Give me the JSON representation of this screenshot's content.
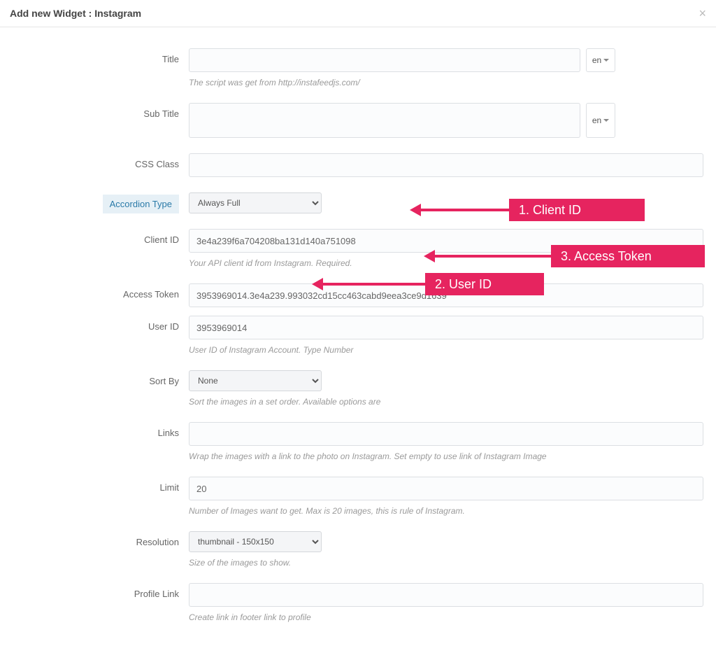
{
  "header": {
    "title": "Add new Widget : Instagram",
    "close_glyph": "×"
  },
  "lang": {
    "label": "en"
  },
  "fields": {
    "title": {
      "label": "Title",
      "value": "",
      "hint": "The script was get from http://instafeedjs.com/"
    },
    "subtitle": {
      "label": "Sub Title",
      "value": ""
    },
    "cssclass": {
      "label": "CSS Class",
      "value": ""
    },
    "accordion": {
      "label": "Accordion Type",
      "selected": "Always Full"
    },
    "clientid": {
      "label": "Client ID",
      "value": "3e4a239f6a704208ba131d140a751098",
      "hint": "Your API client id from Instagram. Required."
    },
    "accesstoken": {
      "label": "Access Token",
      "value": "3953969014.3e4a239.993032cd15cc463cabd9eea3ce9d1639"
    },
    "userid": {
      "label": "User ID",
      "value": "3953969014",
      "hint": "User ID of Instagram Account. Type Number"
    },
    "sortby": {
      "label": "Sort By",
      "selected": "None",
      "hint": "Sort the images in a set order. Available options are"
    },
    "links": {
      "label": "Links",
      "value": "",
      "hint": "Wrap the images with a link to the photo on Instagram. Set empty to use link of Instagram Image"
    },
    "limit": {
      "label": "Limit",
      "value": "20",
      "hint": "Number of Images want to get. Max is 20 images, this is rule of Instagram."
    },
    "resolution": {
      "label": "Resolution",
      "selected": "thumbnail - 150x150",
      "hint": "Size of the images to show."
    },
    "profilelink": {
      "label": "Profile Link",
      "value": "",
      "hint": "Create link in footer link to profile"
    }
  },
  "annotations": {
    "a1": "1. Client ID",
    "a2": "2. User ID",
    "a3": "3. Access Token"
  }
}
